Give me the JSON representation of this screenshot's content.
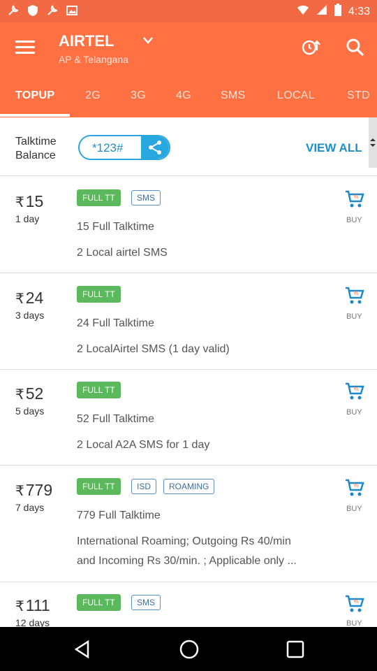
{
  "status_bar": {
    "time": "4:33"
  },
  "header": {
    "operator": "AIRTEL",
    "circle": "AP & Telangana"
  },
  "tabs": [
    {
      "label": "TOPUP",
      "active": true
    },
    {
      "label": "2G"
    },
    {
      "label": "3G"
    },
    {
      "label": "4G"
    },
    {
      "label": "SMS"
    },
    {
      "label": "LOCAL"
    },
    {
      "label": "STD"
    }
  ],
  "balance": {
    "label_line1": "Talktime",
    "label_line2": "Balance",
    "ussd_code": "*123#",
    "view_all": "VIEW ALL"
  },
  "plans": [
    {
      "currency": "₹",
      "price": "15",
      "validity": "1 day",
      "badges_filled": [
        "FULL TT"
      ],
      "badges_outlined": [
        "SMS"
      ],
      "title": "15 Full Talktime",
      "desc_1": "2 Local airtel SMS",
      "desc_2": "",
      "buy": "BUY"
    },
    {
      "currency": "₹",
      "price": "24",
      "validity": "3 days",
      "badges_filled": [
        "FULL TT"
      ],
      "badges_outlined": [],
      "title": "24 Full Talktime",
      "desc_1": "2 LocalAirtel SMS (1 day valid)",
      "desc_2": "",
      "buy": "BUY"
    },
    {
      "currency": "₹",
      "price": "52",
      "validity": "5 days",
      "badges_filled": [
        "FULL TT"
      ],
      "badges_outlined": [],
      "title": "52 Full Talktime",
      "desc_1": "2 Local A2A SMS for 1 day",
      "desc_2": "",
      "buy": "BUY"
    },
    {
      "currency": "₹",
      "price": "779",
      "validity": "7 days",
      "badges_filled": [
        "FULL TT"
      ],
      "badges_outlined": [
        "ISD",
        "ROAMING"
      ],
      "title": "779 Full Talktime",
      "desc_1": "International Roaming; Outgoing Rs 40/min",
      "desc_2": "and Incoming Rs 30/min. ; Applicable only ...",
      "buy": "BUY"
    },
    {
      "currency": "₹",
      "price": "111",
      "validity": "12 days",
      "badges_filled": [
        "FULL TT"
      ],
      "badges_outlined": [
        "SMS"
      ],
      "title": "",
      "desc_1": "",
      "desc_2": "",
      "buy": "BUY"
    }
  ],
  "colors": {
    "header_bg": "#ff7043",
    "status_bg": "#f26a43",
    "accent_blue": "#29a8e0",
    "badge_green": "#5cb85c",
    "cart_blue": "#1e88c8"
  }
}
